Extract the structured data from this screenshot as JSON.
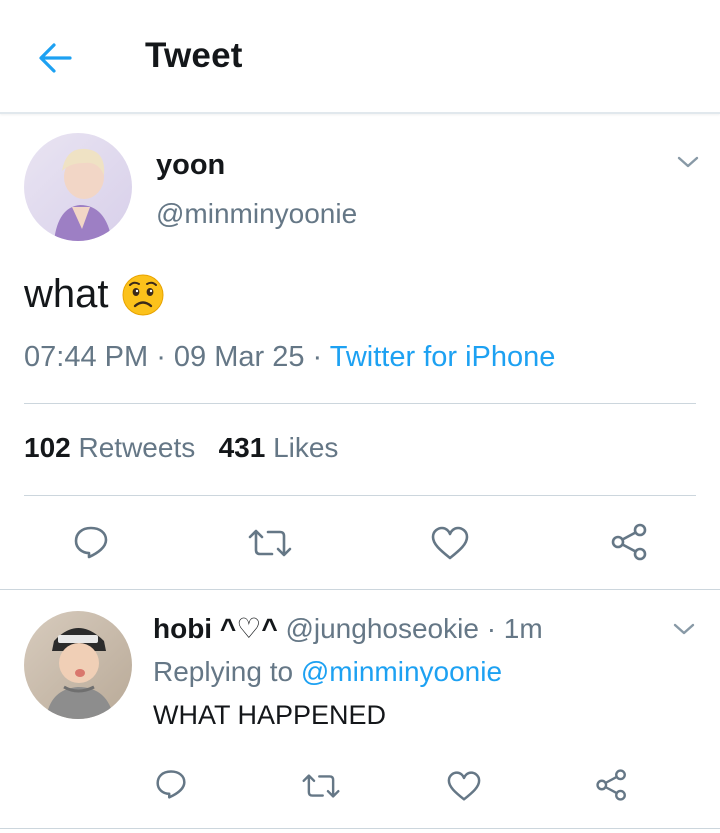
{
  "header": {
    "title": "Tweet",
    "back_icon": "arrow-left-icon",
    "accent": "#1da1f2"
  },
  "tweet": {
    "name": "yoon",
    "handle": "@minminyoonie",
    "text": "what",
    "emoji": "worried-face-emoji",
    "time": "07:44 PM",
    "sep1": " · ",
    "date": "09 Mar 25",
    "sep2": " · ",
    "source": "Twitter for iPhone",
    "retweets_count": "102",
    "retweets_label": "Retweets",
    "likes_count": "431",
    "likes_label": "Likes"
  },
  "reply": {
    "name": "hobi ^♡^",
    "handle": "@junghoseokie",
    "age": " · 1m",
    "replying_prefix": "Replying to ",
    "replying_to": "@minminyoonie",
    "text": "WHAT HAPPENED"
  },
  "colors": {
    "text": "#14171a",
    "muted": "#657786",
    "link": "#1da1f2",
    "divider": "#ccd6dd"
  }
}
